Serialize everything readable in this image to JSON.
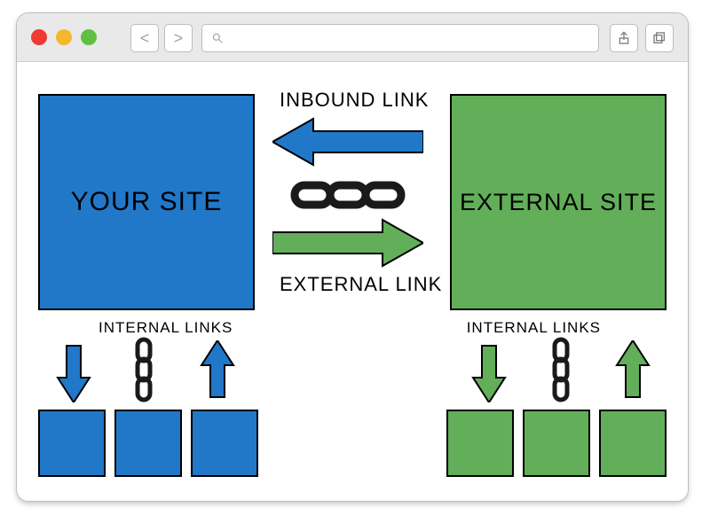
{
  "your_site_label": "YOUR SITE",
  "external_site_label": "EXTERNAL SITE",
  "inbound_link_label": "INBOUND LINK",
  "external_link_label": "EXTERNAL LINK",
  "internal_links_label_left": "INTERNAL LINKS",
  "internal_links_label_right": "INTERNAL LINKS",
  "colors": {
    "your_site": "#2178c9",
    "external_site": "#62ae59",
    "inbound_arrow": "#2178c9",
    "external_arrow": "#62ae59"
  }
}
